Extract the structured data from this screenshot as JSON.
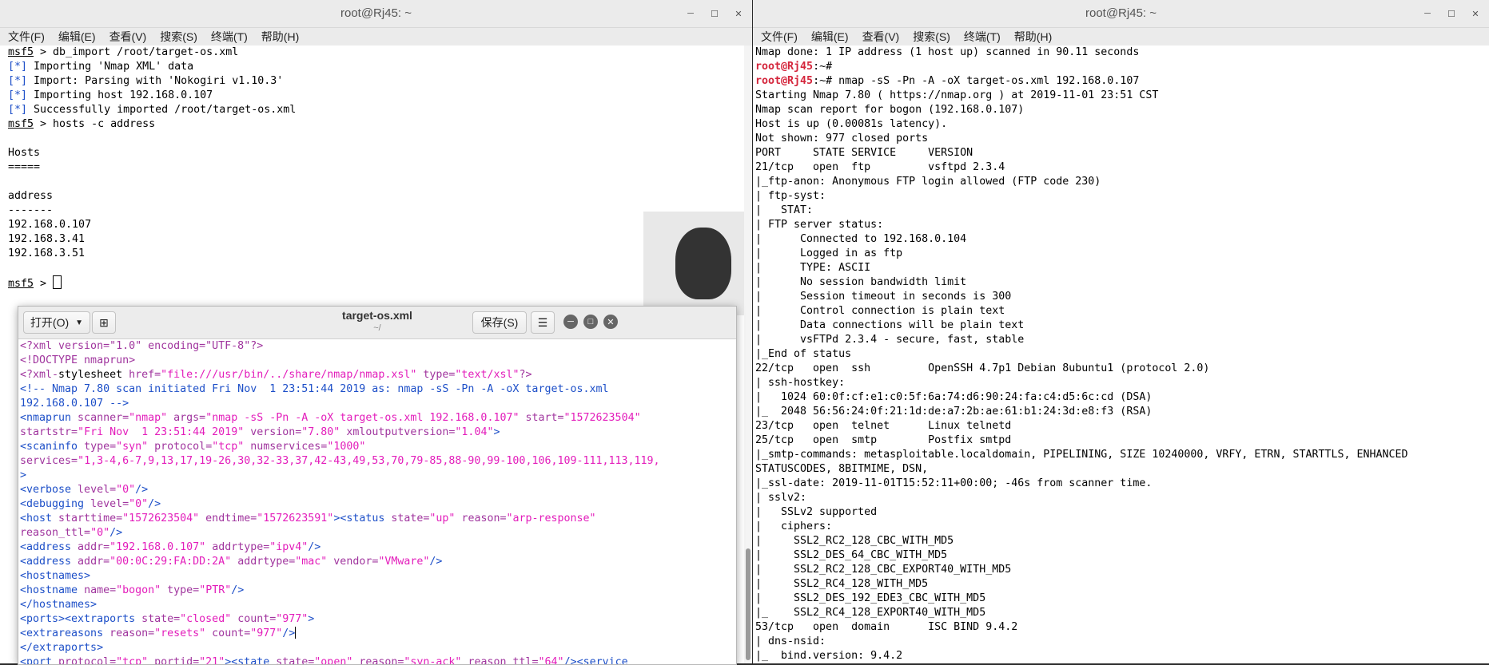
{
  "left_window": {
    "title": "root@Rj45: ~",
    "menu": [
      "文件(F)",
      "编辑(E)",
      "查看(V)",
      "搜索(S)",
      "终端(T)",
      "帮助(H)"
    ],
    "lines": [
      [
        {
          "t": "msf5",
          "c": "u"
        },
        {
          "t": " > db_import /root/target-os.xml"
        }
      ],
      [
        {
          "t": "[*]",
          "c": "c-blue"
        },
        {
          "t": " Importing 'Nmap XML' data"
        }
      ],
      [
        {
          "t": "[*]",
          "c": "c-blue"
        },
        {
          "t": " Import: Parsing with 'Nokogiri v1.10.3'"
        }
      ],
      [
        {
          "t": "[*]",
          "c": "c-blue"
        },
        {
          "t": " Importing host 192.168.0.107"
        }
      ],
      [
        {
          "t": "[*]",
          "c": "c-blue"
        },
        {
          "t": " Successfully imported /root/target-os.xml"
        }
      ],
      [
        {
          "t": "msf5",
          "c": "u"
        },
        {
          "t": " > hosts -c address"
        }
      ],
      [
        {
          "t": ""
        }
      ],
      [
        {
          "t": "Hosts"
        }
      ],
      [
        {
          "t": "====="
        }
      ],
      [
        {
          "t": ""
        }
      ],
      [
        {
          "t": "address"
        }
      ],
      [
        {
          "t": "-------"
        }
      ],
      [
        {
          "t": "192.168.0.107"
        }
      ],
      [
        {
          "t": "192.168.3.41"
        }
      ],
      [
        {
          "t": "192.168.3.51"
        }
      ],
      [
        {
          "t": ""
        }
      ],
      [
        {
          "t": "msf5",
          "c": "u"
        },
        {
          "t": " > "
        },
        {
          "t": "",
          "c": "cursor"
        }
      ]
    ]
  },
  "right_window": {
    "title": "root@Rj45: ~",
    "menu": [
      "文件(F)",
      "编辑(E)",
      "查看(V)",
      "搜索(S)",
      "终端(T)",
      "帮助(H)"
    ],
    "lines": [
      [
        {
          "t": "Nmap done: 1 IP address (1 host up) scanned in 90.11 seconds"
        }
      ],
      [
        {
          "t": "root@Rj45",
          "c": "c-red"
        },
        {
          "t": ":~#"
        }
      ],
      [
        {
          "t": "root@Rj45",
          "c": "c-red"
        },
        {
          "t": ":~# nmap -sS -Pn -A -oX target-os.xml 192.168.0.107"
        }
      ],
      [
        {
          "t": "Starting Nmap 7.80 ( https://nmap.org ) at 2019-11-01 23:51 CST"
        }
      ],
      [
        {
          "t": "Nmap scan report for bogon (192.168.0.107)"
        }
      ],
      [
        {
          "t": "Host is up (0.00081s latency)."
        }
      ],
      [
        {
          "t": "Not shown: 977 closed ports"
        }
      ],
      [
        {
          "t": "PORT     STATE SERVICE     VERSION"
        }
      ],
      [
        {
          "t": "21/tcp   open  ftp         vsftpd 2.3.4"
        }
      ],
      [
        {
          "t": "|_ftp-anon: Anonymous FTP login allowed (FTP code 230)"
        }
      ],
      [
        {
          "t": "| ftp-syst:"
        }
      ],
      [
        {
          "t": "|   STAT:"
        }
      ],
      [
        {
          "t": "| FTP server status:"
        }
      ],
      [
        {
          "t": "|      Connected to 192.168.0.104"
        }
      ],
      [
        {
          "t": "|      Logged in as ftp"
        }
      ],
      [
        {
          "t": "|      TYPE: ASCII"
        }
      ],
      [
        {
          "t": "|      No session bandwidth limit"
        }
      ],
      [
        {
          "t": "|      Session timeout in seconds is 300"
        }
      ],
      [
        {
          "t": "|      Control connection is plain text"
        }
      ],
      [
        {
          "t": "|      Data connections will be plain text"
        }
      ],
      [
        {
          "t": "|      vsFTPd 2.3.4 - secure, fast, stable"
        }
      ],
      [
        {
          "t": "|_End of status"
        }
      ],
      [
        {
          "t": "22/tcp   open  ssh         OpenSSH 4.7p1 Debian 8ubuntu1 (protocol 2.0)"
        }
      ],
      [
        {
          "t": "| ssh-hostkey:"
        }
      ],
      [
        {
          "t": "|   1024 60:0f:cf:e1:c0:5f:6a:74:d6:90:24:fa:c4:d5:6c:cd (DSA)"
        }
      ],
      [
        {
          "t": "|_  2048 56:56:24:0f:21:1d:de:a7:2b:ae:61:b1:24:3d:e8:f3 (RSA)"
        }
      ],
      [
        {
          "t": "23/tcp   open  telnet      Linux telnetd"
        }
      ],
      [
        {
          "t": "25/tcp   open  smtp        Postfix smtpd"
        }
      ],
      [
        {
          "t": "|_smtp-commands: metasploitable.localdomain, PIPELINING, SIZE 10240000, VRFY, ETRN, STARTTLS, ENHANCED"
        }
      ],
      [
        {
          "t": "STATUSCODES, 8BITMIME, DSN,"
        }
      ],
      [
        {
          "t": "|_ssl-date: 2019-11-01T15:52:11+00:00; -46s from scanner time."
        }
      ],
      [
        {
          "t": "| sslv2:"
        }
      ],
      [
        {
          "t": "|   SSLv2 supported"
        }
      ],
      [
        {
          "t": "|   ciphers:"
        }
      ],
      [
        {
          "t": "|     SSL2_RC2_128_CBC_WITH_MD5"
        }
      ],
      [
        {
          "t": "|     SSL2_DES_64_CBC_WITH_MD5"
        }
      ],
      [
        {
          "t": "|     SSL2_RC2_128_CBC_EXPORT40_WITH_MD5"
        }
      ],
      [
        {
          "t": "|     SSL2_RC4_128_WITH_MD5"
        }
      ],
      [
        {
          "t": "|     SSL2_DES_192_EDE3_CBC_WITH_MD5"
        }
      ],
      [
        {
          "t": "|_    SSL2_RC4_128_EXPORT40_WITH_MD5"
        }
      ],
      [
        {
          "t": "53/tcp   open  domain      ISC BIND 9.4.2"
        }
      ],
      [
        {
          "t": "| dns-nsid:"
        }
      ],
      [
        {
          "t": "|_  bind.version: 9.4.2"
        }
      ]
    ]
  },
  "editor": {
    "open_label": "打开(O)",
    "title": "target-os.xml",
    "subtitle": "~/",
    "save_label": "保存(S)",
    "lines": [
      [
        {
          "t": "<?xml version=\"1.0\" encoding=\"UTF-8\"?>",
          "c": "p"
        }
      ],
      [
        {
          "t": "<!DOCTYPE nmaprun>",
          "c": "p"
        }
      ],
      [
        {
          "t": "<?xml-",
          "c": "p"
        },
        {
          "t": "stylesheet"
        },
        {
          "t": " href=",
          "c": "a"
        },
        {
          "t": "\"file:///usr/bin/../share/nmap/nmap.xsl\"",
          "c": "s"
        },
        {
          "t": " type=",
          "c": "a"
        },
        {
          "t": "\"text/xsl\"",
          "c": "s"
        },
        {
          "t": "?>",
          "c": "p"
        }
      ],
      [
        {
          "t": "<!-- Nmap 7.80 scan initiated Fri Nov  1 23:51:44 2019 as: nmap -sS -Pn -A -oX target-os.xml",
          "c": "cm"
        }
      ],
      [
        {
          "t": "192.168.0.107 -->",
          "c": "cm"
        }
      ],
      [
        {
          "t": "<nmaprun",
          "c": "k"
        },
        {
          "t": " scanner=",
          "c": "a"
        },
        {
          "t": "\"nmap\"",
          "c": "s"
        },
        {
          "t": " args=",
          "c": "a"
        },
        {
          "t": "\"nmap -sS -Pn -A -oX target-os.xml 192.168.0.107\"",
          "c": "s"
        },
        {
          "t": " start=",
          "c": "a"
        },
        {
          "t": "\"1572623504\"",
          "c": "s"
        }
      ],
      [
        {
          "t": "startstr=",
          "c": "a"
        },
        {
          "t": "\"Fri Nov  1 23:51:44 2019\"",
          "c": "s"
        },
        {
          "t": " version=",
          "c": "a"
        },
        {
          "t": "\"7.80\"",
          "c": "s"
        },
        {
          "t": " xmloutputversion=",
          "c": "a"
        },
        {
          "t": "\"1.04\"",
          "c": "s"
        },
        {
          "t": ">",
          "c": "k"
        }
      ],
      [
        {
          "t": "<scaninfo",
          "c": "k"
        },
        {
          "t": " type=",
          "c": "a"
        },
        {
          "t": "\"syn\"",
          "c": "s"
        },
        {
          "t": " protocol=",
          "c": "a"
        },
        {
          "t": "\"tcp\"",
          "c": "s"
        },
        {
          "t": " numservices=",
          "c": "a"
        },
        {
          "t": "\"1000\"",
          "c": "s"
        }
      ],
      [
        {
          "t": "services=",
          "c": "a"
        },
        {
          "t": "\"1,3-4,6-7,9,13,17,19-26,30,32-33,37,42-43,49,53,70,79-85,88-90,99-100,106,109-111,113,119,",
          "c": "s"
        }
      ],
      [
        {
          "t": ">",
          "c": "k"
        }
      ],
      [
        {
          "t": "<verbose",
          "c": "k"
        },
        {
          "t": " level=",
          "c": "a"
        },
        {
          "t": "\"0\"",
          "c": "s"
        },
        {
          "t": "/>",
          "c": "k"
        }
      ],
      [
        {
          "t": "<debugging",
          "c": "k"
        },
        {
          "t": " level=",
          "c": "a"
        },
        {
          "t": "\"0\"",
          "c": "s"
        },
        {
          "t": "/>",
          "c": "k"
        }
      ],
      [
        {
          "t": "<host",
          "c": "k"
        },
        {
          "t": " starttime=",
          "c": "a"
        },
        {
          "t": "\"1572623504\"",
          "c": "s"
        },
        {
          "t": " endtime=",
          "c": "a"
        },
        {
          "t": "\"1572623591\"",
          "c": "s"
        },
        {
          "t": "><status",
          "c": "k"
        },
        {
          "t": " state=",
          "c": "a"
        },
        {
          "t": "\"up\"",
          "c": "s"
        },
        {
          "t": " reason=",
          "c": "a"
        },
        {
          "t": "\"arp-response\"",
          "c": "s"
        }
      ],
      [
        {
          "t": "reason_ttl=",
          "c": "a"
        },
        {
          "t": "\"0\"",
          "c": "s"
        },
        {
          "t": "/>",
          "c": "k"
        }
      ],
      [
        {
          "t": "<address",
          "c": "k"
        },
        {
          "t": " addr=",
          "c": "a"
        },
        {
          "t": "\"192.168.0.107\"",
          "c": "s"
        },
        {
          "t": " addrtype=",
          "c": "a"
        },
        {
          "t": "\"ipv4\"",
          "c": "s"
        },
        {
          "t": "/>",
          "c": "k"
        }
      ],
      [
        {
          "t": "<address",
          "c": "k"
        },
        {
          "t": " addr=",
          "c": "a"
        },
        {
          "t": "\"00:0C:29:FA:DD:2A\"",
          "c": "s"
        },
        {
          "t": " addrtype=",
          "c": "a"
        },
        {
          "t": "\"mac\"",
          "c": "s"
        },
        {
          "t": " vendor=",
          "c": "a"
        },
        {
          "t": "\"VMware\"",
          "c": "s"
        },
        {
          "t": "/>",
          "c": "k"
        }
      ],
      [
        {
          "t": "<hostnames>",
          "c": "k"
        }
      ],
      [
        {
          "t": "<hostname",
          "c": "k"
        },
        {
          "t": " name=",
          "c": "a"
        },
        {
          "t": "\"bogon\"",
          "c": "s"
        },
        {
          "t": " type=",
          "c": "a"
        },
        {
          "t": "\"PTR\"",
          "c": "s"
        },
        {
          "t": "/>",
          "c": "k"
        }
      ],
      [
        {
          "t": "</hostnames>",
          "c": "k"
        }
      ],
      [
        {
          "t": "<ports><extraports",
          "c": "k"
        },
        {
          "t": " state=",
          "c": "a"
        },
        {
          "t": "\"closed\"",
          "c": "s"
        },
        {
          "t": " count=",
          "c": "a"
        },
        {
          "t": "\"977\"",
          "c": "s"
        },
        {
          "t": ">",
          "c": "k"
        }
      ],
      [
        {
          "t": "<extrareasons",
          "c": "k"
        },
        {
          "t": " reason=",
          "c": "a"
        },
        {
          "t": "\"resets\"",
          "c": "s"
        },
        {
          "t": " count=",
          "c": "a"
        },
        {
          "t": "\"977\"",
          "c": "s"
        },
        {
          "t": "/>",
          "c": "k"
        },
        {
          "t": "",
          "c": "lc"
        }
      ],
      [
        {
          "t": "</extraports>",
          "c": "k"
        }
      ],
      [
        {
          "t": "<port",
          "c": "k"
        },
        {
          "t": " protocol=",
          "c": "a"
        },
        {
          "t": "\"tcp\"",
          "c": "s"
        },
        {
          "t": " portid=",
          "c": "a"
        },
        {
          "t": "\"21\"",
          "c": "s"
        },
        {
          "t": "><state",
          "c": "k"
        },
        {
          "t": " state=",
          "c": "a"
        },
        {
          "t": "\"open\"",
          "c": "s"
        },
        {
          "t": " reason=",
          "c": "a"
        },
        {
          "t": "\"syn-ack\"",
          "c": "s"
        },
        {
          "t": " reason_ttl=",
          "c": "a"
        },
        {
          "t": "\"64\"",
          "c": "s"
        },
        {
          "t": "/><service",
          "c": "k"
        }
      ]
    ]
  },
  "icons": {
    "minimize": "minimize-icon",
    "maximize": "maximize-icon",
    "close": "close-icon",
    "hamburger": "menu-icon",
    "new_doc": "new-document-icon",
    "dropdown": "chevron-down-icon"
  },
  "colors": {
    "prompt_red": "#d4253b",
    "info_blue": "#1d4fc8",
    "xml_string": "#e31dbb",
    "xml_attr": "#a0359e"
  }
}
